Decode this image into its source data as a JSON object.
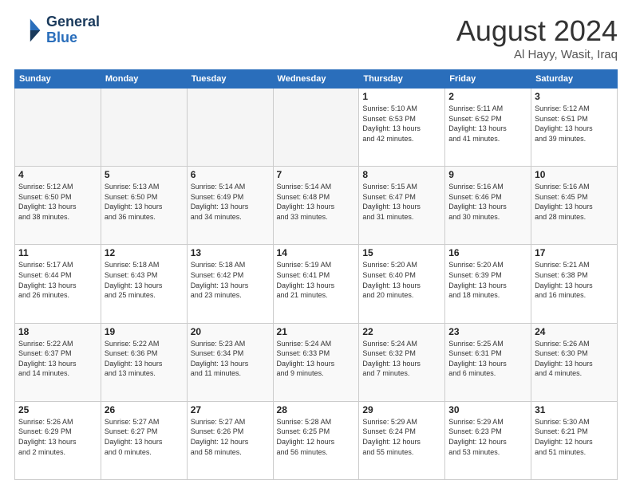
{
  "header": {
    "logo_line1": "General",
    "logo_line2": "Blue",
    "month": "August 2024",
    "location": "Al Hayy, Wasit, Iraq"
  },
  "days_of_week": [
    "Sunday",
    "Monday",
    "Tuesday",
    "Wednesday",
    "Thursday",
    "Friday",
    "Saturday"
  ],
  "weeks": [
    [
      {
        "day": "",
        "info": ""
      },
      {
        "day": "",
        "info": ""
      },
      {
        "day": "",
        "info": ""
      },
      {
        "day": "",
        "info": ""
      },
      {
        "day": "1",
        "info": "Sunrise: 5:10 AM\nSunset: 6:53 PM\nDaylight: 13 hours\nand 42 minutes."
      },
      {
        "day": "2",
        "info": "Sunrise: 5:11 AM\nSunset: 6:52 PM\nDaylight: 13 hours\nand 41 minutes."
      },
      {
        "day": "3",
        "info": "Sunrise: 5:12 AM\nSunset: 6:51 PM\nDaylight: 13 hours\nand 39 minutes."
      }
    ],
    [
      {
        "day": "4",
        "info": "Sunrise: 5:12 AM\nSunset: 6:50 PM\nDaylight: 13 hours\nand 38 minutes."
      },
      {
        "day": "5",
        "info": "Sunrise: 5:13 AM\nSunset: 6:50 PM\nDaylight: 13 hours\nand 36 minutes."
      },
      {
        "day": "6",
        "info": "Sunrise: 5:14 AM\nSunset: 6:49 PM\nDaylight: 13 hours\nand 34 minutes."
      },
      {
        "day": "7",
        "info": "Sunrise: 5:14 AM\nSunset: 6:48 PM\nDaylight: 13 hours\nand 33 minutes."
      },
      {
        "day": "8",
        "info": "Sunrise: 5:15 AM\nSunset: 6:47 PM\nDaylight: 13 hours\nand 31 minutes."
      },
      {
        "day": "9",
        "info": "Sunrise: 5:16 AM\nSunset: 6:46 PM\nDaylight: 13 hours\nand 30 minutes."
      },
      {
        "day": "10",
        "info": "Sunrise: 5:16 AM\nSunset: 6:45 PM\nDaylight: 13 hours\nand 28 minutes."
      }
    ],
    [
      {
        "day": "11",
        "info": "Sunrise: 5:17 AM\nSunset: 6:44 PM\nDaylight: 13 hours\nand 26 minutes."
      },
      {
        "day": "12",
        "info": "Sunrise: 5:18 AM\nSunset: 6:43 PM\nDaylight: 13 hours\nand 25 minutes."
      },
      {
        "day": "13",
        "info": "Sunrise: 5:18 AM\nSunset: 6:42 PM\nDaylight: 13 hours\nand 23 minutes."
      },
      {
        "day": "14",
        "info": "Sunrise: 5:19 AM\nSunset: 6:41 PM\nDaylight: 13 hours\nand 21 minutes."
      },
      {
        "day": "15",
        "info": "Sunrise: 5:20 AM\nSunset: 6:40 PM\nDaylight: 13 hours\nand 20 minutes."
      },
      {
        "day": "16",
        "info": "Sunrise: 5:20 AM\nSunset: 6:39 PM\nDaylight: 13 hours\nand 18 minutes."
      },
      {
        "day": "17",
        "info": "Sunrise: 5:21 AM\nSunset: 6:38 PM\nDaylight: 13 hours\nand 16 minutes."
      }
    ],
    [
      {
        "day": "18",
        "info": "Sunrise: 5:22 AM\nSunset: 6:37 PM\nDaylight: 13 hours\nand 14 minutes."
      },
      {
        "day": "19",
        "info": "Sunrise: 5:22 AM\nSunset: 6:36 PM\nDaylight: 13 hours\nand 13 minutes."
      },
      {
        "day": "20",
        "info": "Sunrise: 5:23 AM\nSunset: 6:34 PM\nDaylight: 13 hours\nand 11 minutes."
      },
      {
        "day": "21",
        "info": "Sunrise: 5:24 AM\nSunset: 6:33 PM\nDaylight: 13 hours\nand 9 minutes."
      },
      {
        "day": "22",
        "info": "Sunrise: 5:24 AM\nSunset: 6:32 PM\nDaylight: 13 hours\nand 7 minutes."
      },
      {
        "day": "23",
        "info": "Sunrise: 5:25 AM\nSunset: 6:31 PM\nDaylight: 13 hours\nand 6 minutes."
      },
      {
        "day": "24",
        "info": "Sunrise: 5:26 AM\nSunset: 6:30 PM\nDaylight: 13 hours\nand 4 minutes."
      }
    ],
    [
      {
        "day": "25",
        "info": "Sunrise: 5:26 AM\nSunset: 6:29 PM\nDaylight: 13 hours\nand 2 minutes."
      },
      {
        "day": "26",
        "info": "Sunrise: 5:27 AM\nSunset: 6:27 PM\nDaylight: 13 hours\nand 0 minutes."
      },
      {
        "day": "27",
        "info": "Sunrise: 5:27 AM\nSunset: 6:26 PM\nDaylight: 12 hours\nand 58 minutes."
      },
      {
        "day": "28",
        "info": "Sunrise: 5:28 AM\nSunset: 6:25 PM\nDaylight: 12 hours\nand 56 minutes."
      },
      {
        "day": "29",
        "info": "Sunrise: 5:29 AM\nSunset: 6:24 PM\nDaylight: 12 hours\nand 55 minutes."
      },
      {
        "day": "30",
        "info": "Sunrise: 5:29 AM\nSunset: 6:23 PM\nDaylight: 12 hours\nand 53 minutes."
      },
      {
        "day": "31",
        "info": "Sunrise: 5:30 AM\nSunset: 6:21 PM\nDaylight: 12 hours\nand 51 minutes."
      }
    ]
  ]
}
